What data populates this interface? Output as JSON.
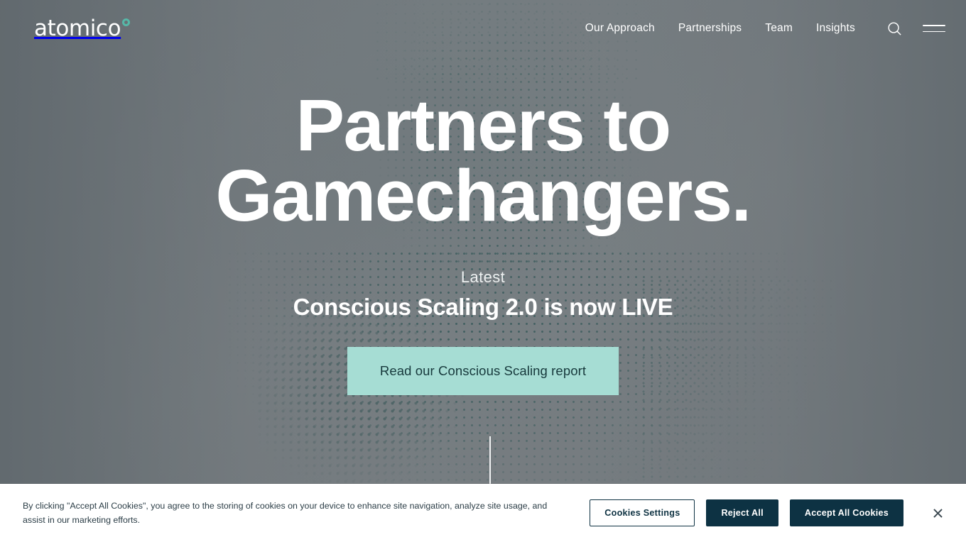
{
  "brand": {
    "name": "atomico",
    "accent_teal": "#56b8a8",
    "cta_mint": "#a6ddd4",
    "cta_text": "#17393c",
    "banner_navy": "#0d3243"
  },
  "header": {
    "nav_items": [
      {
        "label": "Our Approach"
      },
      {
        "label": "Partnerships"
      },
      {
        "label": "Team"
      },
      {
        "label": "Insights"
      }
    ],
    "search_icon": "search-icon",
    "menu_icon": "hamburger-menu-icon"
  },
  "hero": {
    "heading_line_1": "Partners to",
    "heading_line_2": "Gamechangers.",
    "heading_full": "Partners to Gamechangers.",
    "eyebrow": "Latest",
    "subheading": "Conscious Scaling 2.0 is now LIVE",
    "cta_label": "Read our Conscious Scaling report"
  },
  "cookie_banner": {
    "message": "By clicking \"Accept All Cookies\", you agree to the storing of cookies on your device to enhance site navigation, analyze site usage, and assist in our marketing efforts.",
    "settings_label": "Cookies Settings",
    "reject_label": "Reject All",
    "accept_label": "Accept All Cookies",
    "close_icon": "close-icon"
  }
}
